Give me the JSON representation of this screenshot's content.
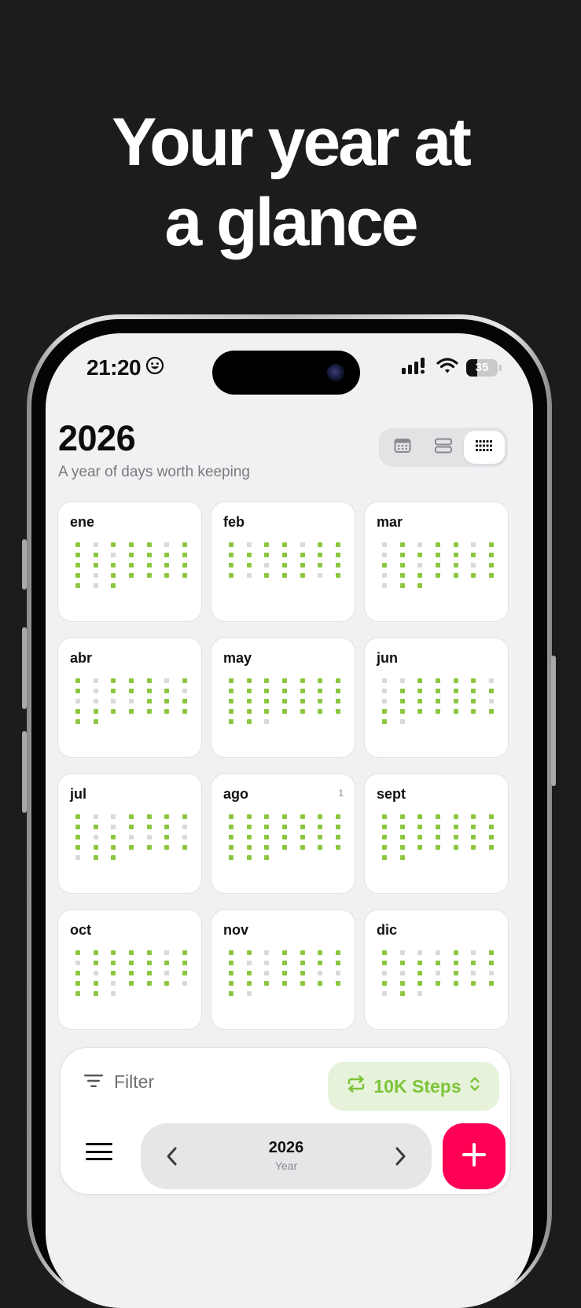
{
  "headline": {
    "line1": "Your year at",
    "line2": "a glance"
  },
  "status_bar": {
    "time": "21:20",
    "battery": "35",
    "battery_level": 0.35
  },
  "header": {
    "year": "2026",
    "subtitle": "A year of days worth keeping"
  },
  "view_modes": [
    {
      "icon": "calendar-icon",
      "active": false
    },
    {
      "icon": "rows-icon",
      "active": false
    },
    {
      "icon": "grid-dots-icon",
      "active": true
    }
  ],
  "months": [
    {
      "name": "ene",
      "badge": "",
      "offset": 0,
      "days": 31,
      "done": [
        1,
        0,
        1,
        1,
        1,
        0,
        1,
        1,
        1,
        0,
        1,
        1,
        1,
        1,
        1,
        1,
        1,
        1,
        1,
        1,
        1,
        1,
        0,
        1,
        1,
        1,
        1,
        1,
        1,
        0,
        1
      ]
    },
    {
      "name": "feb",
      "badge": "",
      "offset": 0,
      "days": 28,
      "done": [
        1,
        0,
        1,
        1,
        0,
        1,
        1,
        1,
        1,
        1,
        1,
        1,
        1,
        1,
        1,
        1,
        0,
        1,
        1,
        1,
        1,
        1,
        0,
        1,
        1,
        1,
        0,
        1
      ]
    },
    {
      "name": "mar",
      "badge": "",
      "offset": 0,
      "days": 31,
      "done": [
        0,
        1,
        0,
        1,
        1,
        0,
        1,
        0,
        1,
        1,
        1,
        1,
        1,
        1,
        1,
        1,
        0,
        1,
        1,
        0,
        1,
        0,
        1,
        1,
        1,
        1,
        1,
        1,
        0,
        1,
        1
      ]
    },
    {
      "name": "abr",
      "badge": "",
      "offset": 0,
      "days": 30,
      "done": [
        1,
        0,
        1,
        1,
        1,
        0,
        1,
        1,
        0,
        1,
        1,
        1,
        1,
        0,
        0,
        0,
        0,
        0,
        1,
        1,
        1,
        1,
        1,
        1,
        1,
        1,
        1,
        1,
        1,
        1
      ]
    },
    {
      "name": "may",
      "badge": "",
      "offset": 0,
      "days": 31,
      "done": [
        1,
        1,
        1,
        1,
        1,
        1,
        1,
        1,
        1,
        1,
        1,
        1,
        1,
        1,
        1,
        1,
        1,
        1,
        1,
        1,
        1,
        1,
        1,
        1,
        1,
        1,
        1,
        1,
        1,
        1,
        0
      ]
    },
    {
      "name": "jun",
      "badge": "",
      "offset": 0,
      "days": 30,
      "done": [
        0,
        0,
        1,
        1,
        1,
        1,
        0,
        0,
        1,
        1,
        1,
        1,
        1,
        1,
        0,
        1,
        1,
        1,
        1,
        1,
        0,
        1,
        1,
        1,
        1,
        1,
        1,
        1,
        1,
        0
      ]
    },
    {
      "name": "jul",
      "badge": "",
      "offset": 0,
      "days": 31,
      "done": [
        1,
        0,
        0,
        1,
        1,
        1,
        1,
        1,
        1,
        0,
        1,
        1,
        1,
        0,
        1,
        0,
        1,
        0,
        0,
        1,
        0,
        1,
        1,
        1,
        1,
        1,
        1,
        1,
        0,
        1,
        1
      ]
    },
    {
      "name": "ago",
      "badge": "1",
      "offset": 0,
      "days": 31,
      "done": [
        1,
        1,
        1,
        1,
        1,
        1,
        1,
        1,
        1,
        1,
        1,
        1,
        1,
        1,
        1,
        1,
        1,
        1,
        1,
        1,
        1,
        1,
        1,
        1,
        1,
        1,
        1,
        1,
        1,
        1,
        1
      ]
    },
    {
      "name": "sept",
      "badge": "",
      "offset": 0,
      "days": 30,
      "done": [
        1,
        1,
        1,
        1,
        1,
        1,
        1,
        1,
        1,
        1,
        1,
        1,
        1,
        1,
        1,
        1,
        1,
        1,
        1,
        1,
        1,
        1,
        1,
        1,
        1,
        1,
        1,
        1,
        1,
        1
      ]
    },
    {
      "name": "oct",
      "badge": "",
      "offset": 0,
      "days": 31,
      "done": [
        1,
        1,
        1,
        1,
        1,
        0,
        1,
        0,
        1,
        1,
        1,
        1,
        1,
        1,
        1,
        0,
        1,
        1,
        1,
        0,
        1,
        1,
        1,
        0,
        1,
        1,
        1,
        0,
        1,
        1,
        0
      ]
    },
    {
      "name": "nov",
      "badge": "",
      "offset": 0,
      "days": 30,
      "done": [
        1,
        1,
        0,
        1,
        1,
        1,
        1,
        1,
        0,
        0,
        1,
        1,
        1,
        1,
        1,
        1,
        0,
        1,
        1,
        0,
        0,
        1,
        1,
        1,
        1,
        1,
        1,
        1,
        1,
        0
      ]
    },
    {
      "name": "dic",
      "badge": "",
      "offset": 0,
      "days": 31,
      "done": [
        1,
        0,
        0,
        0,
        1,
        0,
        1,
        1,
        1,
        1,
        1,
        1,
        1,
        1,
        0,
        0,
        1,
        0,
        1,
        0,
        0,
        1,
        1,
        1,
        1,
        1,
        1,
        1,
        0,
        1,
        0
      ]
    }
  ],
  "bottom_bar": {
    "filter_label": "Filter",
    "habit_label": "10K Steps",
    "nav_year": "2026",
    "nav_label": "Year"
  },
  "colors": {
    "accent_green": "#8cc63f",
    "empty_dot": "#d9d9dc",
    "add_button": "#ff0055",
    "habit_chip_bg": "#e6f3da"
  }
}
